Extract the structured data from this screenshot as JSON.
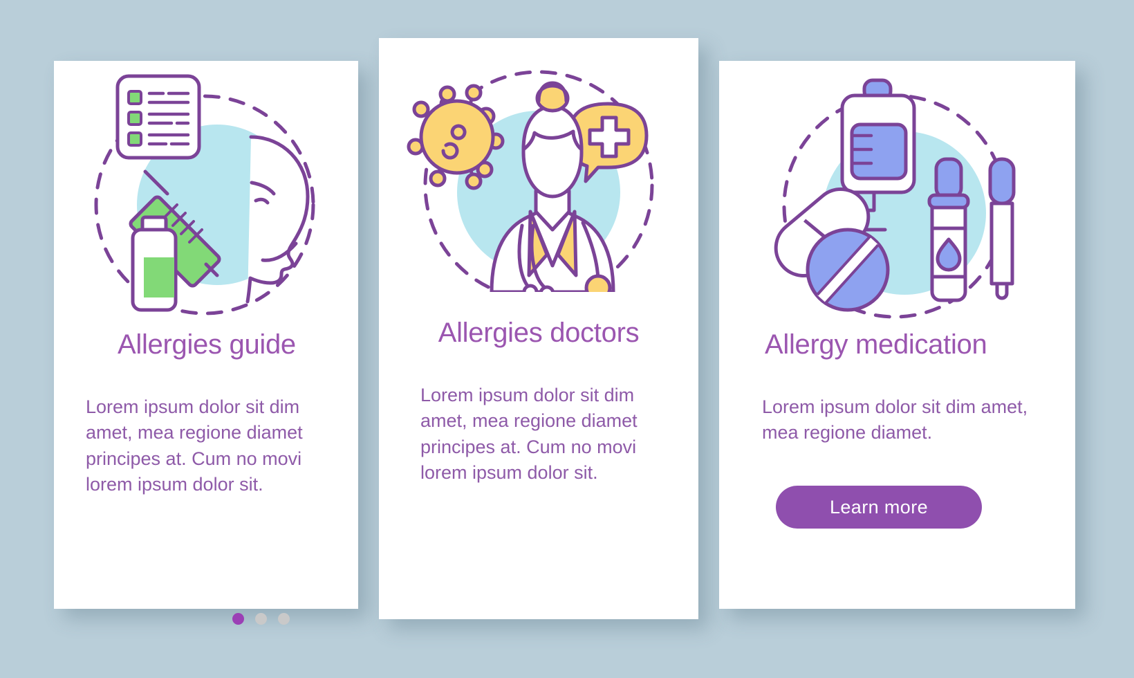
{
  "background_color": "#b9ced9",
  "theme": {
    "title_color": "#9b56b0",
    "body_color": "#8e5aa8",
    "accent_purple": "#8f4fae",
    "outline_purple": "#7b4397",
    "circle_teal": "#b8e6ef",
    "green": "#82d977",
    "yellow": "#fbd474",
    "blue": "#8ea2f0",
    "dot_inactive": "#c9c9c9",
    "dot_active": "#9b3fb5"
  },
  "cards": [
    {
      "id": "allergies-guide",
      "title": "Allergies guide",
      "body": "Lorem ipsum dolor sit dim amet, mea regione diamet principes at. Cum no movi lorem ipsum dolor sit.",
      "illustration": "allergy-test-illustration",
      "icons": [
        "checklist-icon",
        "face-profile-icon",
        "syringe-icon",
        "vial-icon"
      ],
      "dots": [
        "active",
        "inactive",
        "inactive"
      ],
      "has_button": false
    },
    {
      "id": "allergies-doctors",
      "title": "Allergies doctors",
      "body": "Lorem ipsum dolor sit dim amet, mea regione diamet principes at. Cum no movi lorem ipsum dolor sit.",
      "illustration": "doctor-illustration",
      "icons": [
        "virus-icon",
        "female-doctor-icon",
        "stethoscope-icon",
        "medical-cross-speech-bubble-icon"
      ],
      "dots": [
        "inactive",
        "active",
        "inactive"
      ],
      "has_button": false
    },
    {
      "id": "allergy-medication",
      "title": "Allergy medication",
      "body": "Lorem ipsum dolor sit dim amet, mea regione diamet.",
      "illustration": "medication-illustration",
      "icons": [
        "iv-bag-icon",
        "capsule-pill-icon",
        "tablet-pill-icon",
        "dropper-bottle-icon",
        "pipette-icon"
      ],
      "dots": [
        "inactive",
        "inactive",
        "active"
      ],
      "has_button": true,
      "button_label": "Learn more"
    }
  ]
}
